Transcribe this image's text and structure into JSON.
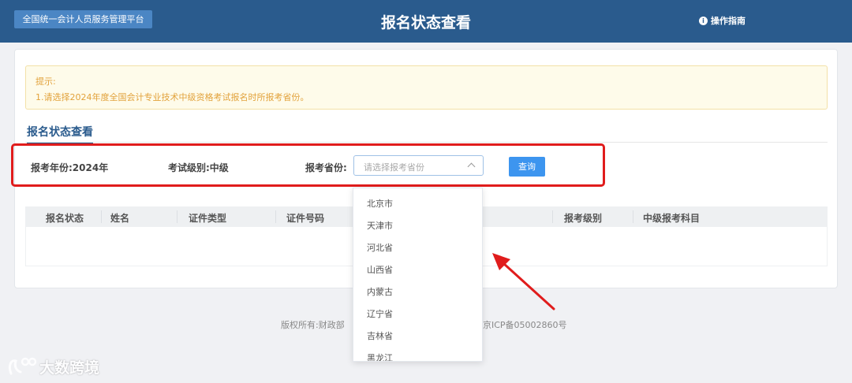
{
  "header": {
    "platform_label": "全国统一会计人员服务管理平台",
    "title": "报名状态查看",
    "guide_label": "操作指南",
    "guide_icon": "info-icon"
  },
  "tip": {
    "title": "提示:",
    "line": "1.请选择2024年度全国会计专业技术中级资格考试报名时所报考省份。"
  },
  "section": {
    "title": "报名状态查看"
  },
  "filters": {
    "year": "报考年份:2024年",
    "level": "考试级别:中级",
    "province_label": "报考省份:",
    "province_placeholder": "请选择报考省份",
    "query_button": "查询"
  },
  "table": {
    "columns": [
      "报名状态",
      "姓名",
      "证件类型",
      "证件号码",
      "报考级别",
      "中级报考科目"
    ]
  },
  "dropdown": {
    "options": [
      "北京市",
      "天津市",
      "河北省",
      "山西省",
      "内蒙古",
      "辽宁省",
      "吉林省",
      "黑龙江"
    ]
  },
  "footer": {
    "left": "版权所有:财政部",
    "right": "京ICP备05002860号"
  },
  "watermark": {
    "text": "大数跨境"
  },
  "colors": {
    "header_bg": "#2a5b8d",
    "accent": "#3d95ef",
    "highlight": "#e01c1c",
    "tip_text": "#e2a23b"
  }
}
